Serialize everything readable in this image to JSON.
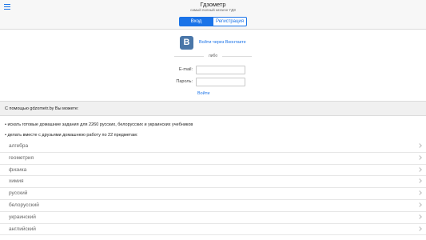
{
  "header": {
    "title": "Гдзометр",
    "subtitle": "самый полный каталог ГДЗ"
  },
  "tabs": [
    {
      "label": "Вход",
      "active": true
    },
    {
      "label": "Регистрация",
      "active": false
    }
  ],
  "vk": {
    "logo_text": "B",
    "link_label": "Войти через Вконтакте"
  },
  "divider": {
    "text": "либо"
  },
  "form": {
    "email_label": "E-mail:",
    "email_value": "",
    "password_label": "Пароль:",
    "password_value": "",
    "submit_label": "Войти"
  },
  "info": {
    "intro": "С помощью gdzometr.by Вы можете:",
    "bullet1": "• искать готовые домашние задания для 2260 русских, белорусских и украинских учебников",
    "bullet2": "• делать вместе с друзьями домашнюю работу по 22 предметам:"
  },
  "subjects": [
    "алгебра",
    "геометрия",
    "физика",
    "химия",
    "русский",
    "белорусский",
    "украинский",
    "английский"
  ],
  "colors": {
    "accent": "#1a73e8",
    "vk": "#4a76a8"
  }
}
